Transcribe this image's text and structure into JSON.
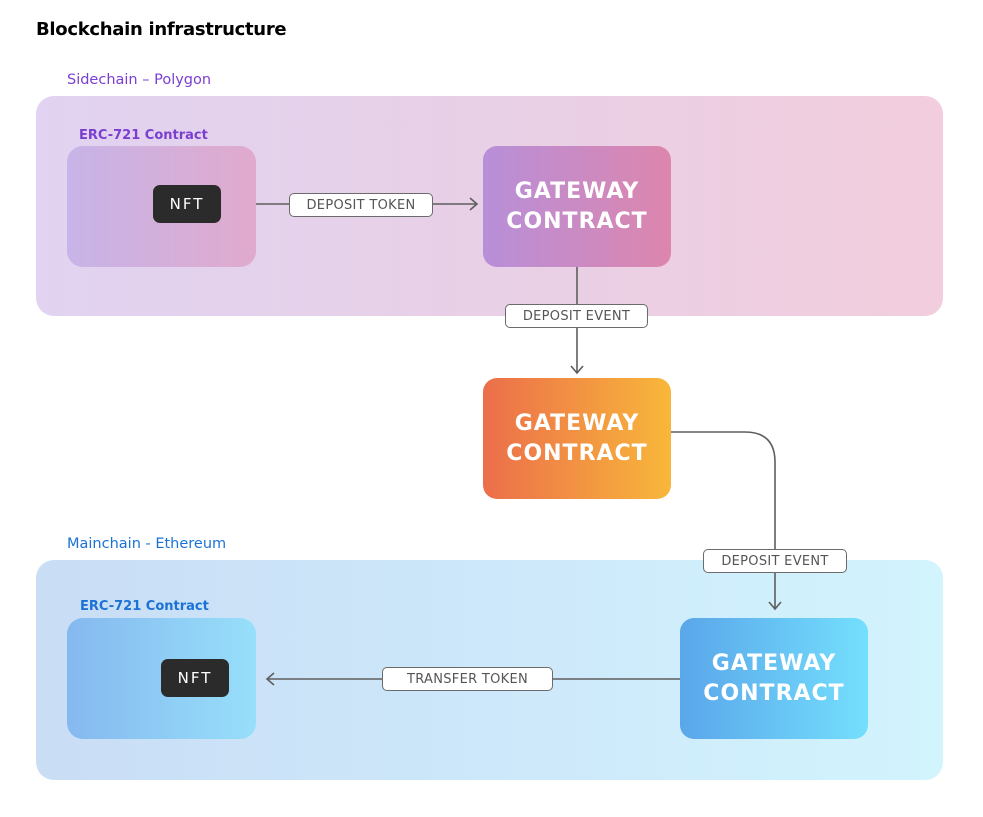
{
  "title": "Blockchain infrastructure",
  "sidechain": {
    "label": "Sidechain – Polygon",
    "contract_label": "ERC-721 Contract",
    "nft_label": "NFT",
    "gateway": [
      "GATEWAY",
      "CONTRACT"
    ],
    "colors": {
      "label": "#7b3fd0",
      "panel_from": "#e1d3f1",
      "panel_to": "#f2cddd"
    }
  },
  "bridge": {
    "gateway": [
      "GATEWAY",
      "CONTRACT"
    ],
    "colors": {
      "from": "#ec6e4b",
      "to": "#f8b73a"
    }
  },
  "mainchain": {
    "label": "Mainchain - Ethereum",
    "contract_label": "ERC-721 Contract",
    "nft_label": "NFT",
    "gateway": [
      "GATEWAY",
      "CONTRACT"
    ],
    "colors": {
      "label": "#1b72d6",
      "panel_from": "#c9ddf5",
      "panel_to": "#d2f4fd"
    }
  },
  "edges": [
    {
      "from": "sidechain-nft",
      "to": "sidechain-gateway",
      "label": "DEPOSIT TOKEN"
    },
    {
      "from": "sidechain-gateway",
      "to": "bridge-gateway",
      "label": "DEPOSIT EVENT"
    },
    {
      "from": "bridge-gateway",
      "to": "mainchain-gateway",
      "label": "DEPOSIT EVENT"
    },
    {
      "from": "mainchain-gateway",
      "to": "mainchain-nft",
      "label": "TRANSFER TOKEN"
    }
  ]
}
